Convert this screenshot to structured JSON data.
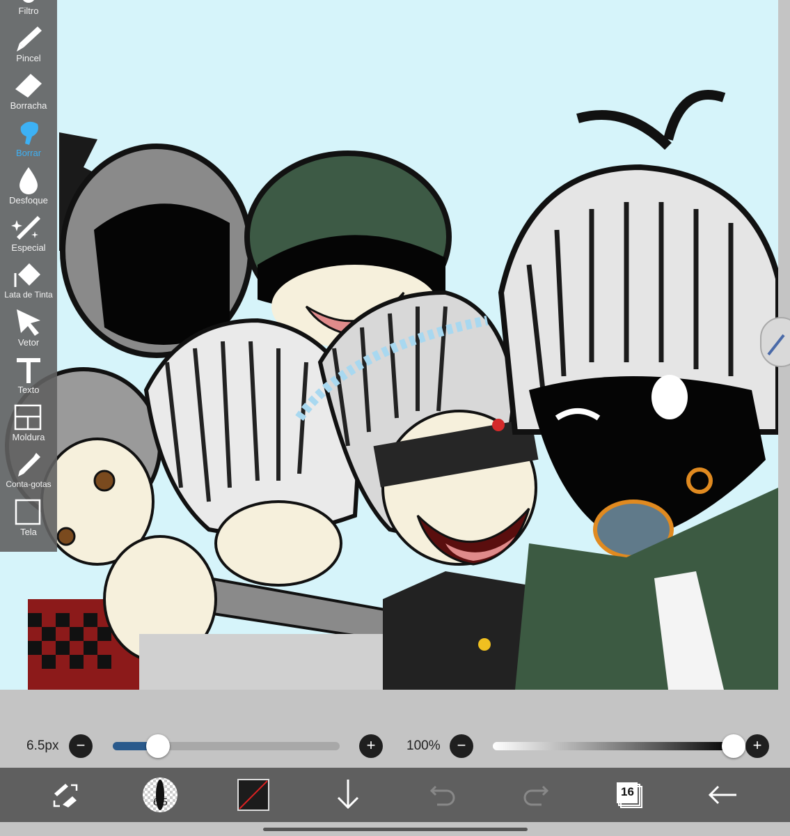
{
  "tools": [
    {
      "id": "filter",
      "label": "Filtro",
      "icon": "filter-icon",
      "active": false
    },
    {
      "id": "brush",
      "label": "Pincel",
      "icon": "brush-icon",
      "active": false
    },
    {
      "id": "eraser",
      "label": "Borracha",
      "icon": "eraser-icon",
      "active": false
    },
    {
      "id": "smudge",
      "label": "Borrar",
      "icon": "smudge-icon",
      "active": true
    },
    {
      "id": "blur",
      "label": "Desfoque",
      "icon": "blur-drop-icon",
      "active": false
    },
    {
      "id": "special",
      "label": "Especial",
      "icon": "magic-wand-icon",
      "active": false
    },
    {
      "id": "fill",
      "label": "Lata de Tinta",
      "icon": "paint-bucket-icon",
      "active": false
    },
    {
      "id": "vector",
      "label": "Vetor",
      "icon": "arrow-cursor-icon",
      "active": false
    },
    {
      "id": "text",
      "label": "Texto",
      "icon": "text-t-icon",
      "active": false
    },
    {
      "id": "frame",
      "label": "Moldura",
      "icon": "frame-icon",
      "active": false
    },
    {
      "id": "eyedropper",
      "label": "Conta-gotas",
      "icon": "eyedropper-icon",
      "active": false
    },
    {
      "id": "canvas",
      "label": "Tela",
      "icon": "canvas-icon",
      "active": false
    }
  ],
  "brush_size": {
    "value_label": "6.5px",
    "level": 0.2
  },
  "opacity": {
    "value_label": "100%",
    "level": 1.0
  },
  "bottom_bar": {
    "brush_size_badge": "6.5",
    "layers_count": "16"
  },
  "colors": {
    "active_tool": "#3db1f5",
    "slider_fill": "#2a5a8c",
    "canvas_sky": "#d6f4fa",
    "panel": "#606060"
  }
}
